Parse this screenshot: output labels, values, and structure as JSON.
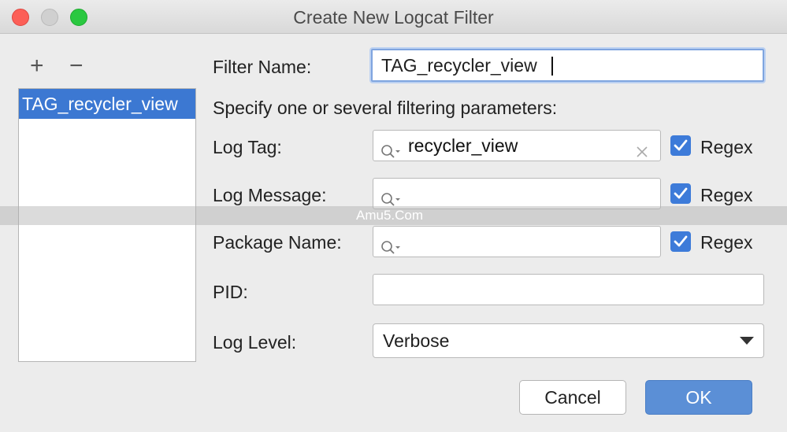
{
  "window": {
    "title": "Create New Logcat Filter"
  },
  "toolbar": {
    "add_symbol": "+",
    "remove_symbol": "−"
  },
  "filter_list": {
    "items": [
      "TAG_recycler_view"
    ],
    "selected_index": 0
  },
  "form": {
    "filter_name": {
      "label": "Filter Name:",
      "value": "TAG_recycler_view"
    },
    "instructions": "Specify one or several filtering parameters:",
    "log_tag": {
      "label": "Log Tag:",
      "value": "recycler_view",
      "regex_checked": true,
      "regex_label": "Regex"
    },
    "log_message": {
      "label": "Log Message:",
      "value": "",
      "regex_checked": true,
      "regex_label": "Regex"
    },
    "package_name": {
      "label": "Package Name:",
      "value": "",
      "regex_checked": true,
      "regex_label": "Regex"
    },
    "pid": {
      "label": "PID:",
      "value": ""
    },
    "log_level": {
      "label": "Log Level:",
      "value": "Verbose"
    }
  },
  "buttons": {
    "cancel": "Cancel",
    "ok": "OK"
  },
  "watermark": "Amu5.Com",
  "colors": {
    "accent": "#3c78d2",
    "checkbox": "#3d7bd9",
    "ok_button": "#5b8fd6",
    "close": "#fc5f57",
    "maximize": "#2ac840"
  }
}
